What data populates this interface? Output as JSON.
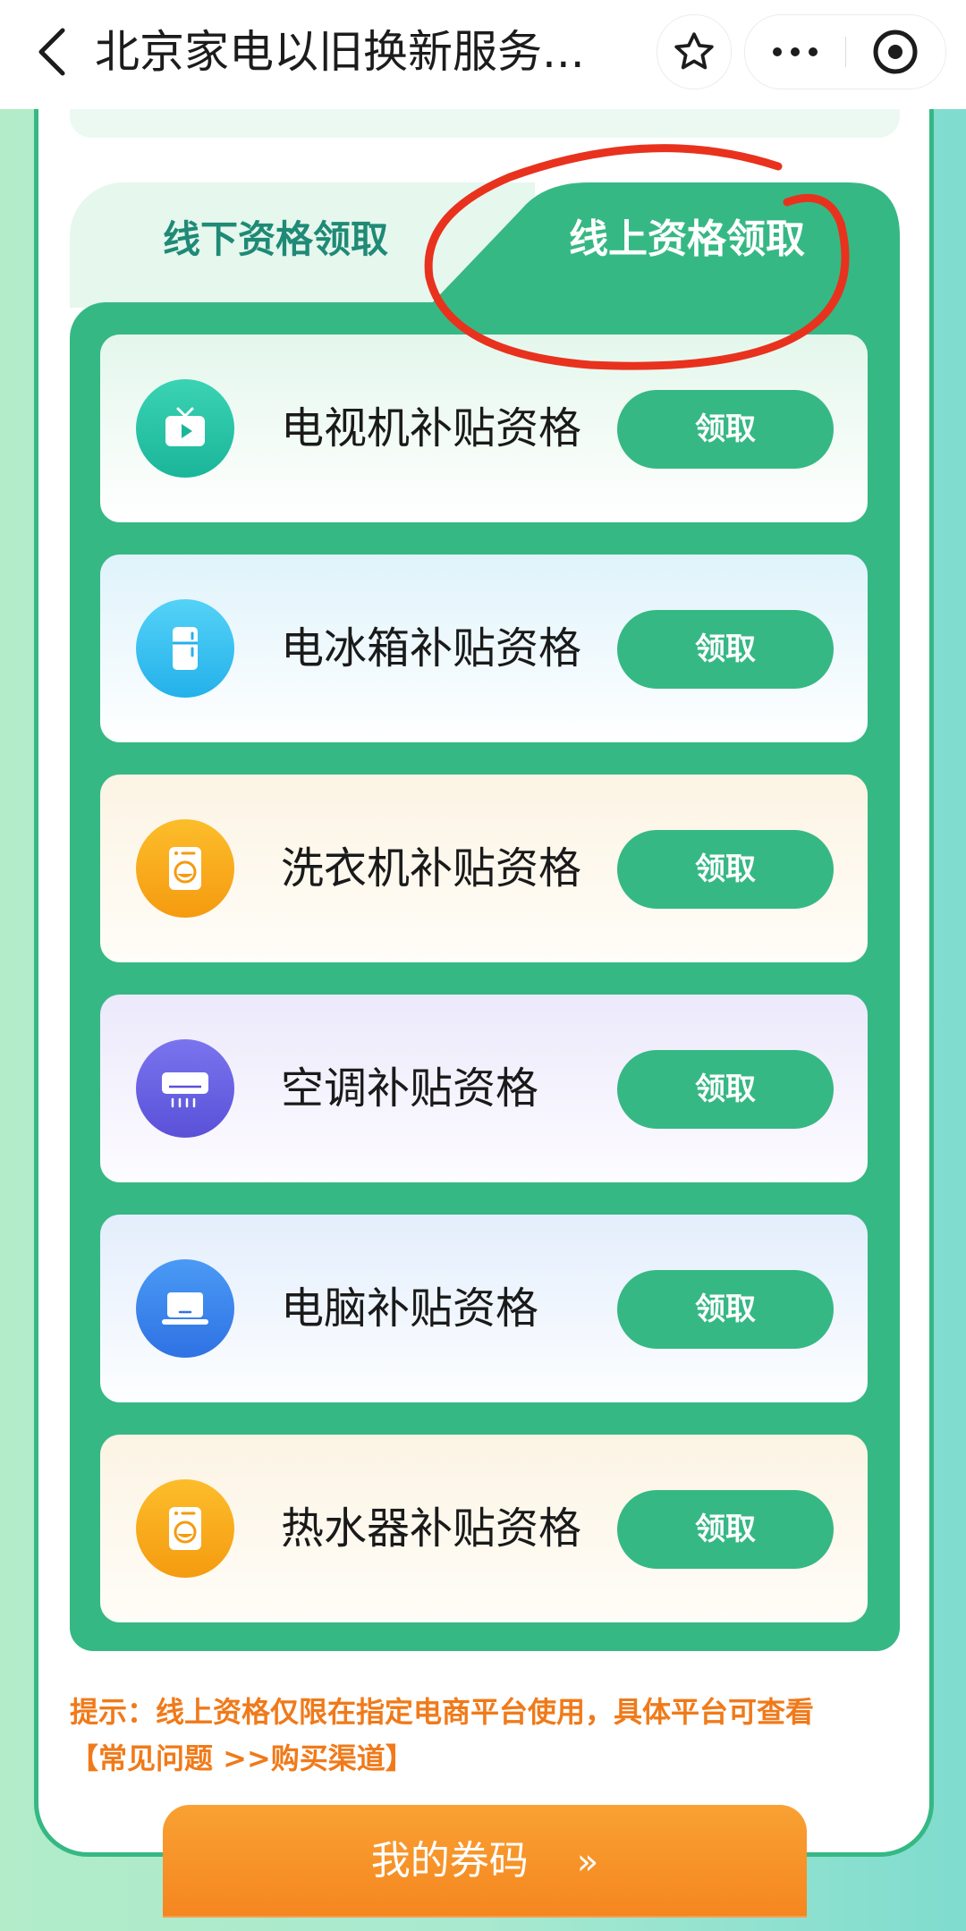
{
  "navbar": {
    "title": "北京家电以旧换新服务..."
  },
  "tabs": {
    "offline_label": "线下资格领取",
    "online_label": "线上资格领取",
    "active": "online"
  },
  "items": [
    {
      "label": "电视机补贴资格",
      "button": "领取",
      "icon": "tv-icon"
    },
    {
      "label": "电冰箱补贴资格",
      "button": "领取",
      "icon": "fridge-icon"
    },
    {
      "label": "洗衣机补贴资格",
      "button": "领取",
      "icon": "washing-machine-icon"
    },
    {
      "label": "空调补贴资格",
      "button": "领取",
      "icon": "air-conditioner-icon"
    },
    {
      "label": "电脑补贴资格",
      "button": "领取",
      "icon": "laptop-icon"
    },
    {
      "label": "热水器补贴资格",
      "button": "领取",
      "icon": "water-heater-icon"
    }
  ],
  "tip": {
    "line1": "提示：线上资格仅限在指定电商平台使用，具体平台可查看",
    "line2": "【常见问题 >>购买渠道】"
  },
  "bottom": {
    "label": "我的券码",
    "chevron": "»"
  },
  "colors": {
    "brand_green": "#36b884",
    "tip_orange": "#f07a1a",
    "button_orange": "#f5861f",
    "annotation_red": "#e8321e"
  }
}
